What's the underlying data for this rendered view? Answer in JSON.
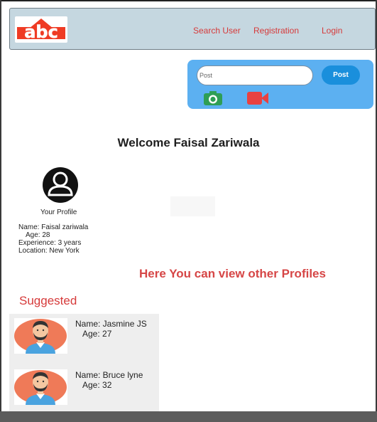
{
  "colors": {
    "navbar_bg": "#c5d7e0",
    "nav_link": "#d63a3a",
    "post_panel": "#5cb0f1",
    "post_button": "#1a8fdc",
    "camera_icon": "#2e9e55",
    "video_icon": "#e84141",
    "heading_red": "#d64646"
  },
  "header": {
    "logo_text": "abc",
    "nav": [
      {
        "label": "Search User"
      },
      {
        "label": "Registration"
      },
      {
        "label": "Login"
      }
    ]
  },
  "post": {
    "placeholder": "Post",
    "button_label": "Post",
    "camera_icon": "camera-icon",
    "video_icon": "video-camera-icon"
  },
  "welcome": "Welcome Faisal Zariwala",
  "profile": {
    "title": "Your Profile",
    "name": "Name: Faisal zariwala",
    "age": "Age: 28",
    "experience": "Experience: 3 years",
    "location": "Location: New York"
  },
  "view_heading": "Here You can view other Profiles",
  "suggested": {
    "heading": "Suggested",
    "people": [
      {
        "name": "Name: Jasmine JS",
        "age": "Age: 27"
      },
      {
        "name": "Name: Bruce lyne",
        "age": "Age: 32"
      }
    ]
  }
}
